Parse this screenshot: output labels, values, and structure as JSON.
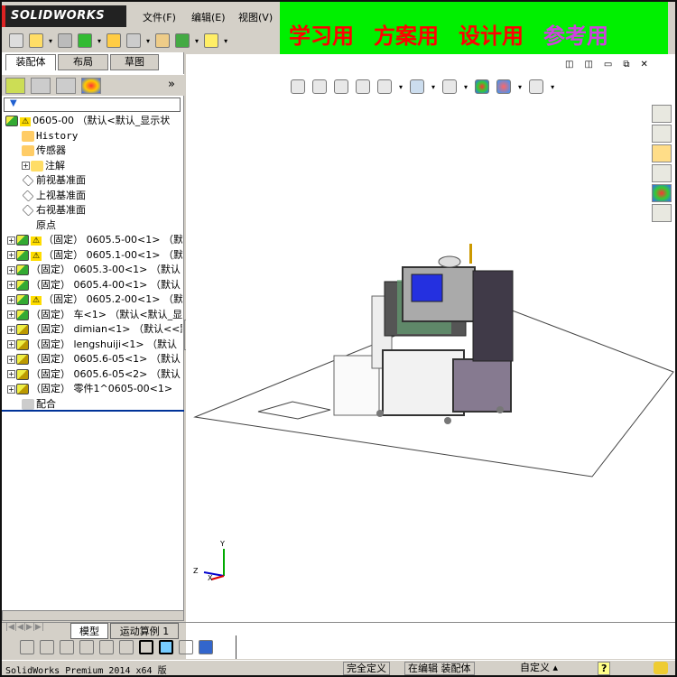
{
  "app": {
    "logo": "SOLIDWORKS",
    "menus": [
      "文件(F)",
      "编辑(E)",
      "视图(V)"
    ]
  },
  "banner": [
    "学习用",
    "方案用",
    "设计用",
    "参考用"
  ],
  "colors": {
    "banner_bg": "#00f000",
    "banner_text": "#ff0000",
    "banner_accent": "#d040e0",
    "tree_line": "#003399"
  },
  "left_tabs": [
    "装配体",
    "布局",
    "草图"
  ],
  "panel": {
    "more": "»",
    "filter_icon": "filter-icon"
  },
  "tree": [
    {
      "label": "0605-00 （默认<默认_显示状",
      "icon": "asm",
      "warn": true,
      "lvl": 0
    },
    {
      "label": "History",
      "icon": "history",
      "lvl": 1
    },
    {
      "label": "传感器",
      "icon": "sensor",
      "lvl": 1
    },
    {
      "label": "注解",
      "icon": "annot",
      "lvl": 1,
      "plus": true
    },
    {
      "label": "前视基准面",
      "icon": "plane",
      "lvl": 1
    },
    {
      "label": "上视基准面",
      "icon": "plane",
      "lvl": 1
    },
    {
      "label": "右视基准面",
      "icon": "plane",
      "lvl": 1
    },
    {
      "label": "原点",
      "icon": "origin",
      "lvl": 1
    },
    {
      "label": "（固定） 0605.5-00<1> （默",
      "icon": "asm",
      "warn": true,
      "plus": true
    },
    {
      "label": "（固定） 0605.1-00<1> （默",
      "icon": "asm",
      "warn": true,
      "plus": true
    },
    {
      "label": "（固定） 0605.3-00<1> （默认",
      "icon": "asm",
      "plus": true
    },
    {
      "label": "（固定） 0605.4-00<1> （默认",
      "icon": "asm",
      "plus": true
    },
    {
      "label": "（固定） 0605.2-00<1> （默",
      "icon": "asm",
      "warn": true,
      "plus": true
    },
    {
      "label": "（固定） 车<1> （默认<默认_显",
      "icon": "asm",
      "plus": true
    },
    {
      "label": "（固定） dimian<1> （默认<<默",
      "icon": "prt",
      "plus": true
    },
    {
      "label": "（固定） lengshuiji<1> （默认",
      "icon": "prt",
      "plus": true
    },
    {
      "label": "（固定） 0605.6-05<1> （默认",
      "icon": "prt",
      "plus": true
    },
    {
      "label": "（固定） 0605.6-05<2> （默认",
      "icon": "prt",
      "plus": true
    },
    {
      "label": "（固定） 零件1^0605-00<1> （",
      "icon": "prt",
      "plus": true
    },
    {
      "label": "配合",
      "icon": "mate",
      "lvl": 1
    }
  ],
  "bottom_tabs": [
    "模型",
    "运动算例 1"
  ],
  "triad": {
    "x": "X",
    "y": "Y",
    "z": "Z"
  },
  "status": {
    "product": "SolidWorks Premium 2014 x64 版",
    "state": "完全定义",
    "editing": "在编辑 装配体",
    "units": "自定义",
    "help": "?"
  }
}
